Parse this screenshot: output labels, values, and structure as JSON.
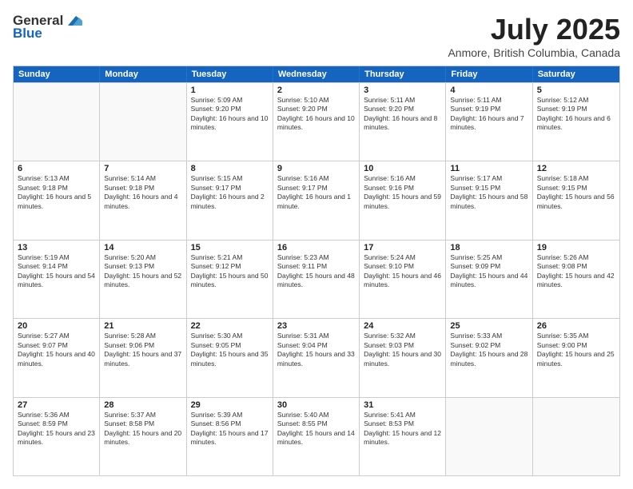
{
  "header": {
    "logo_general": "General",
    "logo_blue": "Blue",
    "title": "July 2025",
    "location": "Anmore, British Columbia, Canada"
  },
  "weekdays": [
    "Sunday",
    "Monday",
    "Tuesday",
    "Wednesday",
    "Thursday",
    "Friday",
    "Saturday"
  ],
  "weeks": [
    [
      {
        "day": "",
        "empty": true
      },
      {
        "day": "",
        "empty": true
      },
      {
        "day": "1",
        "sunrise": "Sunrise: 5:09 AM",
        "sunset": "Sunset: 9:20 PM",
        "daylight": "Daylight: 16 hours and 10 minutes."
      },
      {
        "day": "2",
        "sunrise": "Sunrise: 5:10 AM",
        "sunset": "Sunset: 9:20 PM",
        "daylight": "Daylight: 16 hours and 10 minutes."
      },
      {
        "day": "3",
        "sunrise": "Sunrise: 5:11 AM",
        "sunset": "Sunset: 9:20 PM",
        "daylight": "Daylight: 16 hours and 8 minutes."
      },
      {
        "day": "4",
        "sunrise": "Sunrise: 5:11 AM",
        "sunset": "Sunset: 9:19 PM",
        "daylight": "Daylight: 16 hours and 7 minutes."
      },
      {
        "day": "5",
        "sunrise": "Sunrise: 5:12 AM",
        "sunset": "Sunset: 9:19 PM",
        "daylight": "Daylight: 16 hours and 6 minutes."
      }
    ],
    [
      {
        "day": "6",
        "sunrise": "Sunrise: 5:13 AM",
        "sunset": "Sunset: 9:18 PM",
        "daylight": "Daylight: 16 hours and 5 minutes."
      },
      {
        "day": "7",
        "sunrise": "Sunrise: 5:14 AM",
        "sunset": "Sunset: 9:18 PM",
        "daylight": "Daylight: 16 hours and 4 minutes."
      },
      {
        "day": "8",
        "sunrise": "Sunrise: 5:15 AM",
        "sunset": "Sunset: 9:17 PM",
        "daylight": "Daylight: 16 hours and 2 minutes."
      },
      {
        "day": "9",
        "sunrise": "Sunrise: 5:16 AM",
        "sunset": "Sunset: 9:17 PM",
        "daylight": "Daylight: 16 hours and 1 minute."
      },
      {
        "day": "10",
        "sunrise": "Sunrise: 5:16 AM",
        "sunset": "Sunset: 9:16 PM",
        "daylight": "Daylight: 15 hours and 59 minutes."
      },
      {
        "day": "11",
        "sunrise": "Sunrise: 5:17 AM",
        "sunset": "Sunset: 9:15 PM",
        "daylight": "Daylight: 15 hours and 58 minutes."
      },
      {
        "day": "12",
        "sunrise": "Sunrise: 5:18 AM",
        "sunset": "Sunset: 9:15 PM",
        "daylight": "Daylight: 15 hours and 56 minutes."
      }
    ],
    [
      {
        "day": "13",
        "sunrise": "Sunrise: 5:19 AM",
        "sunset": "Sunset: 9:14 PM",
        "daylight": "Daylight: 15 hours and 54 minutes."
      },
      {
        "day": "14",
        "sunrise": "Sunrise: 5:20 AM",
        "sunset": "Sunset: 9:13 PM",
        "daylight": "Daylight: 15 hours and 52 minutes."
      },
      {
        "day": "15",
        "sunrise": "Sunrise: 5:21 AM",
        "sunset": "Sunset: 9:12 PM",
        "daylight": "Daylight: 15 hours and 50 minutes."
      },
      {
        "day": "16",
        "sunrise": "Sunrise: 5:23 AM",
        "sunset": "Sunset: 9:11 PM",
        "daylight": "Daylight: 15 hours and 48 minutes."
      },
      {
        "day": "17",
        "sunrise": "Sunrise: 5:24 AM",
        "sunset": "Sunset: 9:10 PM",
        "daylight": "Daylight: 15 hours and 46 minutes."
      },
      {
        "day": "18",
        "sunrise": "Sunrise: 5:25 AM",
        "sunset": "Sunset: 9:09 PM",
        "daylight": "Daylight: 15 hours and 44 minutes."
      },
      {
        "day": "19",
        "sunrise": "Sunrise: 5:26 AM",
        "sunset": "Sunset: 9:08 PM",
        "daylight": "Daylight: 15 hours and 42 minutes."
      }
    ],
    [
      {
        "day": "20",
        "sunrise": "Sunrise: 5:27 AM",
        "sunset": "Sunset: 9:07 PM",
        "daylight": "Daylight: 15 hours and 40 minutes."
      },
      {
        "day": "21",
        "sunrise": "Sunrise: 5:28 AM",
        "sunset": "Sunset: 9:06 PM",
        "daylight": "Daylight: 15 hours and 37 minutes."
      },
      {
        "day": "22",
        "sunrise": "Sunrise: 5:30 AM",
        "sunset": "Sunset: 9:05 PM",
        "daylight": "Daylight: 15 hours and 35 minutes."
      },
      {
        "day": "23",
        "sunrise": "Sunrise: 5:31 AM",
        "sunset": "Sunset: 9:04 PM",
        "daylight": "Daylight: 15 hours and 33 minutes."
      },
      {
        "day": "24",
        "sunrise": "Sunrise: 5:32 AM",
        "sunset": "Sunset: 9:03 PM",
        "daylight": "Daylight: 15 hours and 30 minutes."
      },
      {
        "day": "25",
        "sunrise": "Sunrise: 5:33 AM",
        "sunset": "Sunset: 9:02 PM",
        "daylight": "Daylight: 15 hours and 28 minutes."
      },
      {
        "day": "26",
        "sunrise": "Sunrise: 5:35 AM",
        "sunset": "Sunset: 9:00 PM",
        "daylight": "Daylight: 15 hours and 25 minutes."
      }
    ],
    [
      {
        "day": "27",
        "sunrise": "Sunrise: 5:36 AM",
        "sunset": "Sunset: 8:59 PM",
        "daylight": "Daylight: 15 hours and 23 minutes."
      },
      {
        "day": "28",
        "sunrise": "Sunrise: 5:37 AM",
        "sunset": "Sunset: 8:58 PM",
        "daylight": "Daylight: 15 hours and 20 minutes."
      },
      {
        "day": "29",
        "sunrise": "Sunrise: 5:39 AM",
        "sunset": "Sunset: 8:56 PM",
        "daylight": "Daylight: 15 hours and 17 minutes."
      },
      {
        "day": "30",
        "sunrise": "Sunrise: 5:40 AM",
        "sunset": "Sunset: 8:55 PM",
        "daylight": "Daylight: 15 hours and 14 minutes."
      },
      {
        "day": "31",
        "sunrise": "Sunrise: 5:41 AM",
        "sunset": "Sunset: 8:53 PM",
        "daylight": "Daylight: 15 hours and 12 minutes."
      },
      {
        "day": "",
        "empty": true
      },
      {
        "day": "",
        "empty": true
      }
    ]
  ]
}
